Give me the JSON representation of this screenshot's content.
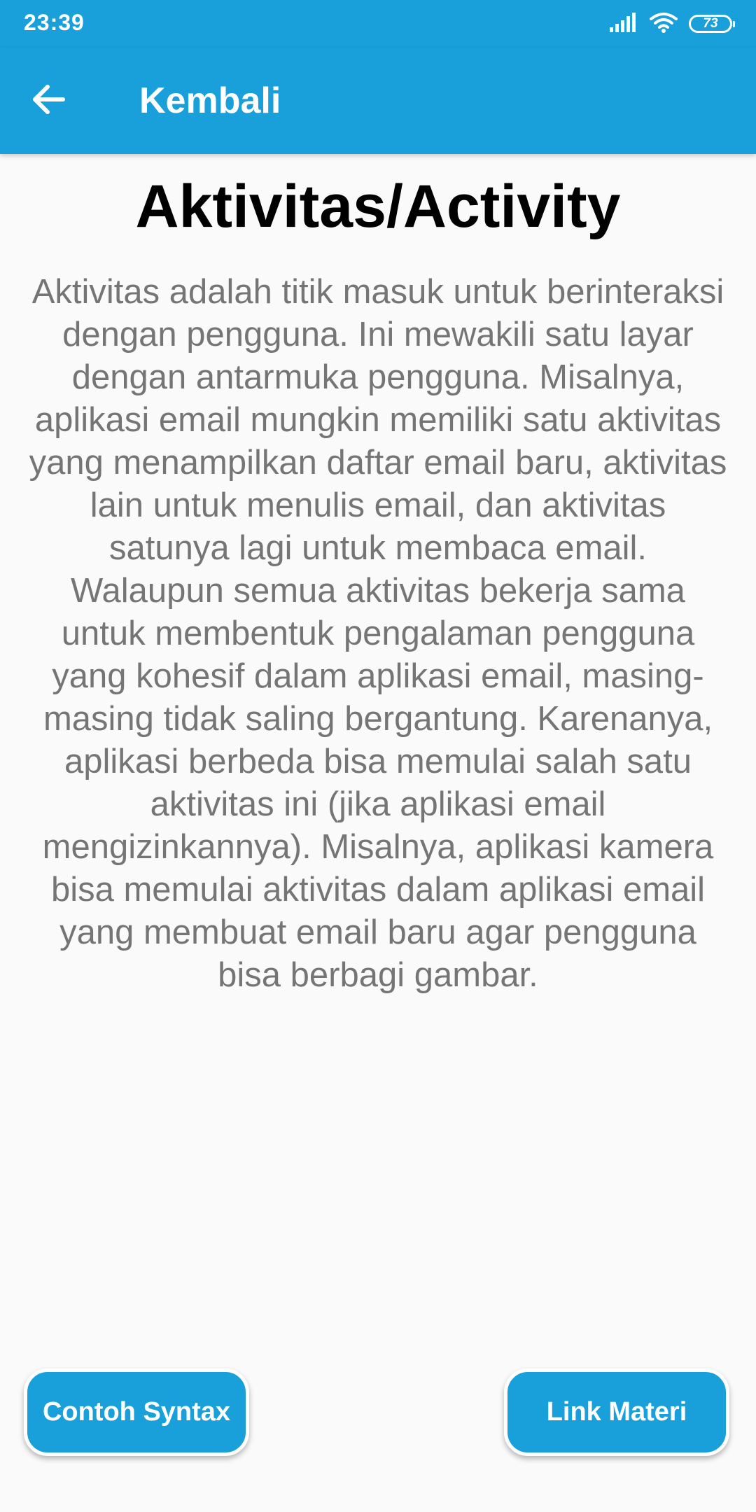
{
  "status_bar": {
    "time": "23:39",
    "battery_level": "73",
    "icons": [
      "signal-icon",
      "wifi-icon",
      "battery-icon"
    ]
  },
  "app_bar": {
    "back_icon": "arrow-back-icon",
    "title": "Kembali"
  },
  "content": {
    "title": "Aktivitas/Activity",
    "body": "Aktivitas adalah titik masuk untuk berinteraksi dengan pengguna. Ini mewakili satu layar dengan antarmuka pengguna. Misalnya, aplikasi email mungkin memiliki satu aktivitas yang menampilkan daftar email baru, aktivitas lain untuk menulis email, dan aktivitas satunya lagi untuk membaca email. Walaupun semua aktivitas bekerja sama untuk membentuk pengalaman pengguna yang kohesif dalam aplikasi email, masing-masing tidak saling bergantung. Karenanya, aplikasi berbeda bisa memulai salah satu aktivitas ini (jika aplikasi email mengizinkannya). Misalnya, aplikasi kamera bisa memulai aktivitas dalam aplikasi email yang membuat email baru agar pengguna bisa berbagi gambar."
  },
  "buttons": {
    "left_label": "Contoh Syntax",
    "right_label": "Link Materi"
  },
  "colors": {
    "primary": "#199fda",
    "background": "#fafafa",
    "title_text": "#000000",
    "body_text": "#757575",
    "on_primary": "#ffffff"
  }
}
